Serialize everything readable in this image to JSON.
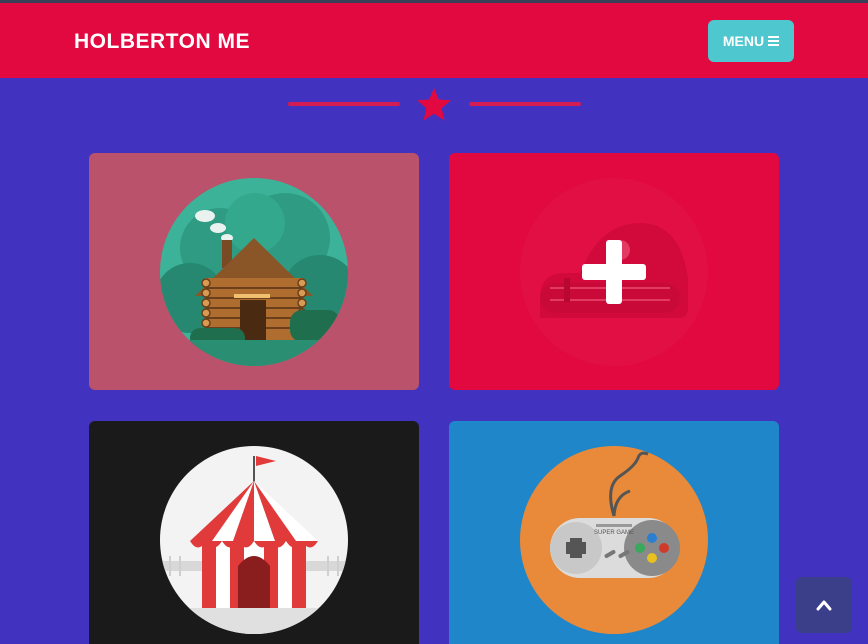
{
  "header": {
    "brand": "HOLBERTON ME",
    "menu_label": "MENU",
    "menu_icon": "bars-icon"
  },
  "colors": {
    "page_bg": "#4133c0",
    "navbar_bg": "#e1093f",
    "menu_button_bg": "#4fc7cf",
    "divider": "#d41c52",
    "back_to_top_bg": "#3b3e88"
  },
  "divider": {
    "icon": "star-icon"
  },
  "portfolio": {
    "items": [
      {
        "image": "log-cabin-illustration",
        "bg": "#b9526a"
      },
      {
        "image": "submarine-illustration",
        "bg": "#e1093f",
        "overlay_icon": "plus-icon"
      },
      {
        "image": "circus-tent-illustration",
        "bg": "#1a1a1a"
      },
      {
        "image": "game-controller-illustration",
        "bg": "#1f86c9",
        "controller_text": "SUPER GAME"
      }
    ]
  },
  "back_to_top": {
    "icon": "chevron-up-icon"
  }
}
